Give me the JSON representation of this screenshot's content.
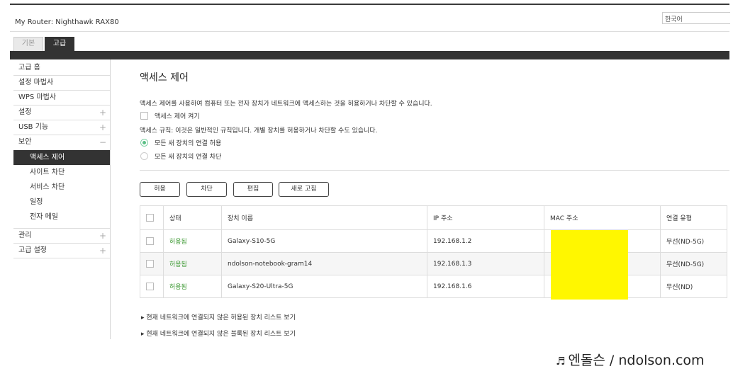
{
  "header": {
    "router_label": "My Router:",
    "router_model": "Nighthawk RAX80",
    "language": "한국어"
  },
  "tabs": {
    "basic": "기본",
    "advanced": "고급"
  },
  "sidebar": {
    "items": [
      {
        "label": "고급 홈"
      },
      {
        "label": "설정 마법사"
      },
      {
        "label": "WPS 마법사"
      },
      {
        "label": "설정",
        "toggle": "+"
      },
      {
        "label": "USB 기능",
        "toggle": "+"
      },
      {
        "label": "보안",
        "toggle": "−"
      }
    ],
    "sub_items": [
      {
        "label": "액세스 제어",
        "active": true
      },
      {
        "label": "사이트 차단"
      },
      {
        "label": "서비스 차단"
      },
      {
        "label": "일정"
      },
      {
        "label": "전자 메일"
      }
    ],
    "bottom_items": [
      {
        "label": "관리",
        "toggle": "+"
      },
      {
        "label": "고급 설정",
        "toggle": "+"
      }
    ]
  },
  "main": {
    "title": "액세스 제어",
    "description": "액세스 제어를 사용하여 컴퓨터 또는 전자 장치가 네트워크에 액세스하는 것을 허용하거나 차단할 수 있습니다.",
    "enable_label": "액세스 제어 켜기",
    "rule_text": "액세스 규칙: 이것은 일반적인 규칙입니다. 개별 장치를 허용하거나 차단할 수도 있습니다.",
    "radio_allow": "모든 새 장치의 연결 허용",
    "radio_block": "모든 새 장치의 연결 차단",
    "buttons": {
      "allow": "허용",
      "block": "차단",
      "edit": "편집",
      "refresh": "새로 고침"
    },
    "table": {
      "headers": [
        "상태",
        "장치 이름",
        "IP 주소",
        "MAC 주소",
        "연결 유형"
      ],
      "rows": [
        {
          "status": "허용됨",
          "name": "Galaxy-S10-5G",
          "ip": "192.168.1.2",
          "type": "무선(ND-5G)"
        },
        {
          "status": "허용됨",
          "name": "ndolson-notebook-gram14",
          "ip": "192.168.1.3",
          "type": "무선(ND-5G)"
        },
        {
          "status": "허용됨",
          "name": "Galaxy-S20-Ultra-5G",
          "ip": "192.168.1.6",
          "type": "무선(ND)"
        }
      ]
    },
    "link_allowed": "▸ 현재 네트워크에 연결되지 않은 허용된 장치 리스트 보기",
    "link_blocked": "▸ 현재 네트워크에 연결되지 않은 블록된 장치 리스트 보기"
  },
  "watermark": {
    "icon": "♬",
    "text": "엔돌슨 / ndolson.com"
  },
  "colors": {
    "status_green": "#3f9a35",
    "mask_yellow": "#fff700",
    "radio_green": "#5bbf86"
  }
}
